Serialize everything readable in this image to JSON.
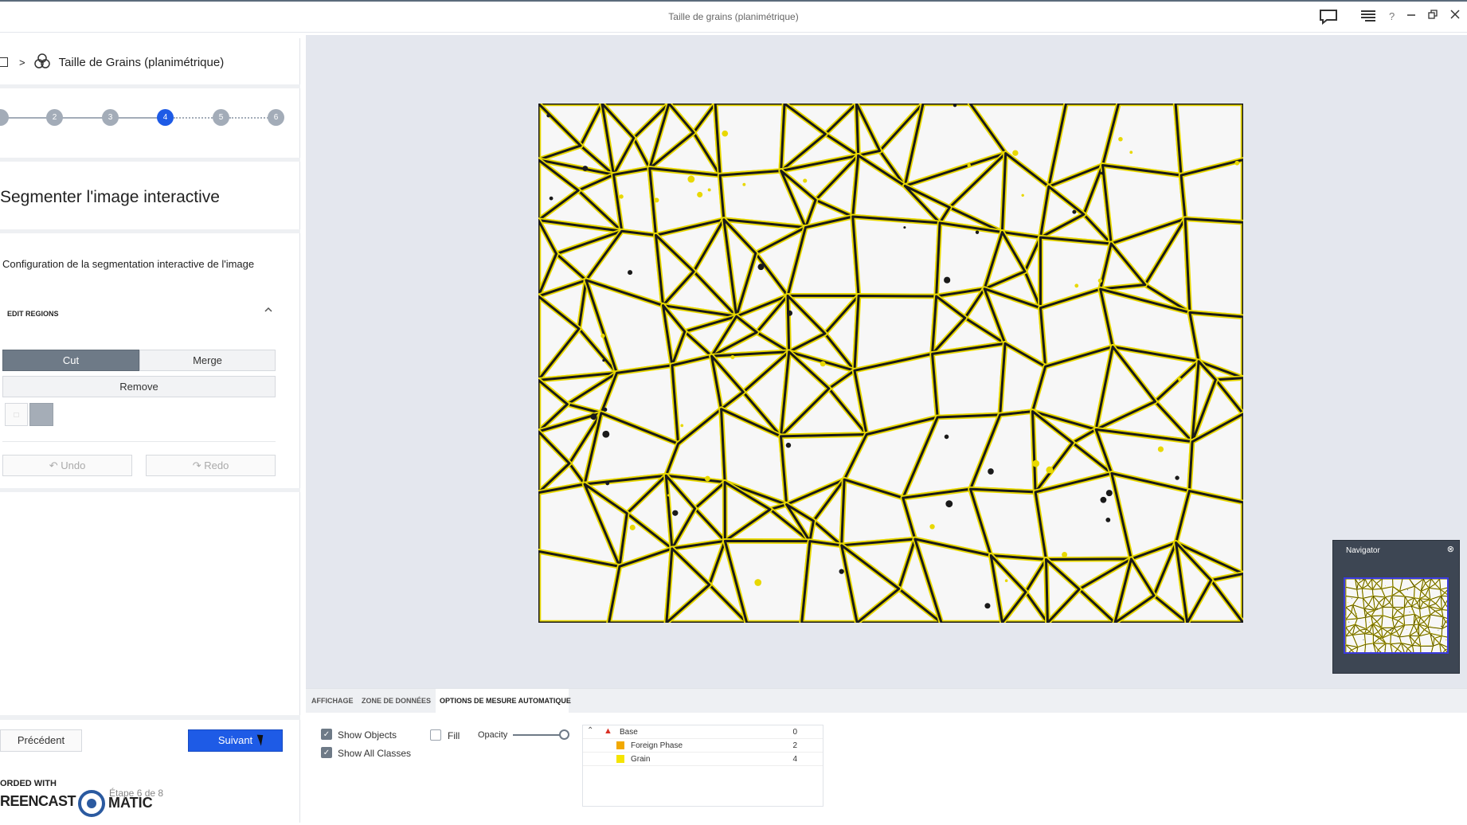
{
  "window": {
    "title": "Taille de grains (planimétrique)",
    "icons": [
      "chat-icon",
      "menu-icon",
      "help-icon",
      "minimize-icon",
      "restore-icon",
      "close-icon"
    ],
    "help_glyph": "?"
  },
  "breadcrumb": {
    "separator": ">",
    "current": "Taille de Grains (planimétrique)"
  },
  "stepper": {
    "steps": [
      "",
      "2",
      "3",
      "4",
      "5",
      "6"
    ],
    "active_index": 3
  },
  "panel": {
    "title": "Segmenter l'image interactive",
    "subtitle": "Configuration de la segmentation interactive de l'image",
    "section": "EDIT REGIONS",
    "buttons": {
      "cut": "Cut",
      "merge": "Merge",
      "remove": "Remove",
      "undo": "Undo",
      "redo": "Redo"
    }
  },
  "footer": {
    "previous": "Précédent",
    "next": "Suivant",
    "step_count": "Étape 6 de 8",
    "watermark_line1": "ORDED WITH",
    "watermark_line2": "REENCAST",
    "watermark_line3": "MATIC"
  },
  "navigator": {
    "title": "Navigator"
  },
  "bottom": {
    "tabs": [
      "AFFICHAGE",
      "ZONE DE DONNÉES",
      "OPTIONS DE MESURE AUTOMATIQUE"
    ],
    "active_tab": 2,
    "show_objects": "Show Objects",
    "show_all_classes": "Show All Classes",
    "fill": "Fill",
    "opacity": "Opacity",
    "opacity_value": 1.0,
    "classes": [
      {
        "name": "Base",
        "value": "0",
        "color": "#d93025"
      },
      {
        "name": "Foreign Phase",
        "value": "2",
        "color": "#f2a900"
      },
      {
        "name": "Grain",
        "value": "4",
        "color": "#f5e400"
      }
    ]
  },
  "colors": {
    "accent": "#1e5be6",
    "grain_boundary": "#f0e020",
    "canvas_bg": "#e4e7ee"
  }
}
